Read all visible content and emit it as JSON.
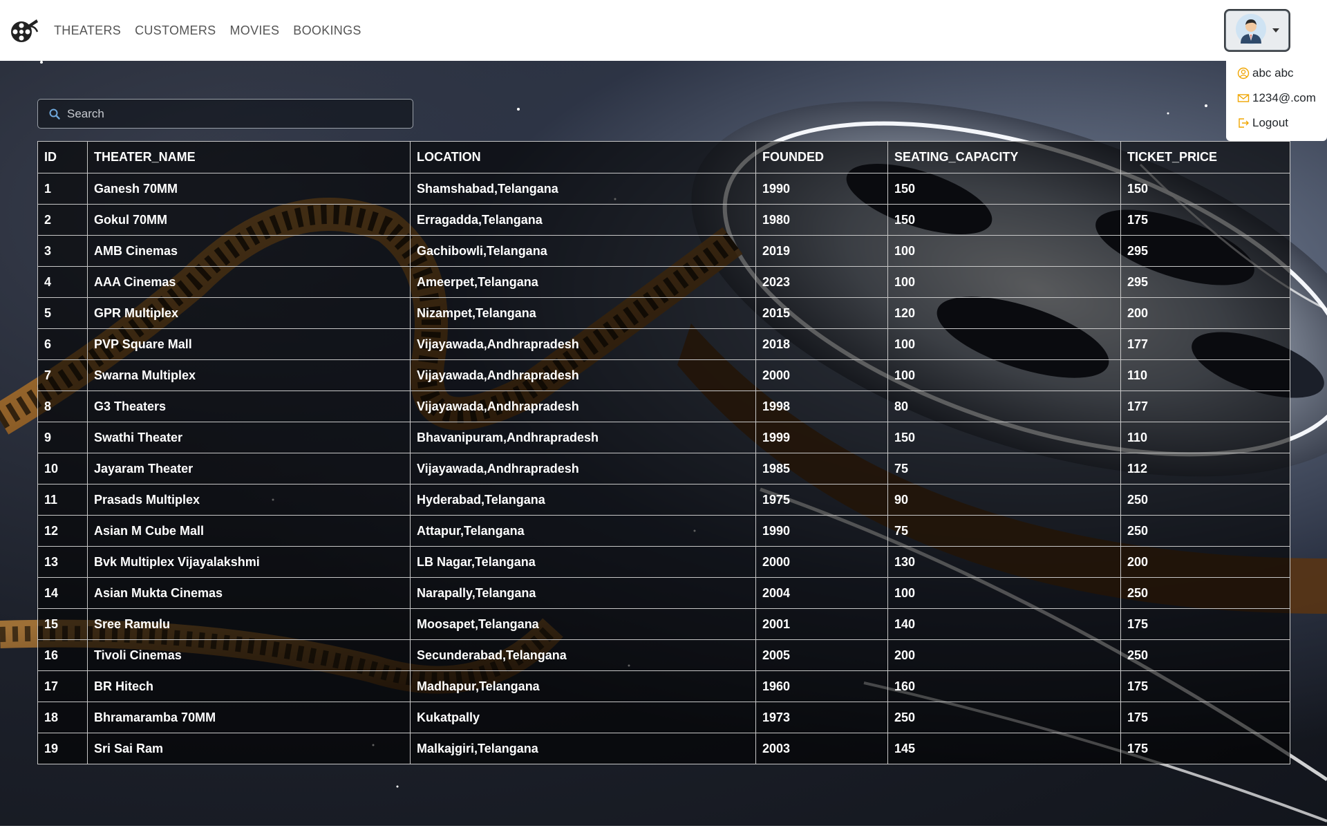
{
  "nav": {
    "links": [
      "THEATERS",
      "CUSTOMERS",
      "MOVIES",
      "BOOKINGS"
    ]
  },
  "user_menu": {
    "name": "abc abc",
    "email": "1234@.com",
    "logout_label": "Logout"
  },
  "search": {
    "placeholder": "Search",
    "value": ""
  },
  "table": {
    "columns": [
      "ID",
      "THEATER_NAME",
      "LOCATION",
      "FOUNDED",
      "SEATING_CAPACITY",
      "TICKET_PRICE"
    ],
    "rows": [
      [
        "1",
        "Ganesh 70MM",
        "Shamshabad,Telangana",
        "1990",
        "150",
        "150"
      ],
      [
        "2",
        "Gokul 70MM",
        "Erragadda,Telangana",
        "1980",
        "150",
        "175"
      ],
      [
        "3",
        "AMB Cinemas",
        "Gachibowli,Telangana",
        "2019",
        "100",
        "295"
      ],
      [
        "4",
        "AAA Cinemas",
        "Ameerpet,Telangana",
        "2023",
        "100",
        "295"
      ],
      [
        "5",
        "GPR Multiplex",
        "Nizampet,Telangana",
        "2015",
        "120",
        "200"
      ],
      [
        "6",
        "PVP Square Mall",
        "Vijayawada,Andhrapradesh",
        "2018",
        "100",
        "177"
      ],
      [
        "7",
        "Swarna Multiplex",
        "Vijayawada,Andhrapradesh",
        "2000",
        "100",
        "110"
      ],
      [
        "8",
        "G3 Theaters",
        "Vijayawada,Andhrapradesh",
        "1998",
        "80",
        "177"
      ],
      [
        "9",
        "Swathi Theater",
        "Bhavanipuram,Andhrapradesh",
        "1999",
        "150",
        "110"
      ],
      [
        "10",
        "Jayaram Theater",
        "Vijayawada,Andhrapradesh",
        "1985",
        "75",
        "112"
      ],
      [
        "11",
        "Prasads Multiplex",
        "Hyderabad,Telangana",
        "1975",
        "90",
        "250"
      ],
      [
        "12",
        "Asian M Cube Mall",
        "Attapur,Telangana",
        "1990",
        "75",
        "250"
      ],
      [
        "13",
        "Bvk Multiplex Vijayalakshmi",
        "LB Nagar,Telangana",
        "2000",
        "130",
        "200"
      ],
      [
        "14",
        "Asian Mukta Cinemas",
        "Narapally,Telangana",
        "2004",
        "100",
        "250"
      ],
      [
        "15",
        "Sree Ramulu",
        "Moosapet,Telangana",
        "2001",
        "140",
        "175"
      ],
      [
        "16",
        "Tivoli Cinemas",
        "Secunderabad,Telangana",
        "2005",
        "200",
        "250"
      ],
      [
        "17",
        "BR Hitech",
        "Madhapur,Telangana",
        "1960",
        "160",
        "175"
      ],
      [
        "18",
        "Bhramaramba 70MM",
        "Kukatpally",
        "1973",
        "250",
        "175"
      ],
      [
        "19",
        "Sri Sai Ram",
        "Malkajgiri,Telangana",
        "2003",
        "145",
        "175"
      ]
    ]
  },
  "colors": {
    "nav_link": "#555555",
    "table_text": "#ffffff",
    "icon_accent": "#f0a500"
  }
}
